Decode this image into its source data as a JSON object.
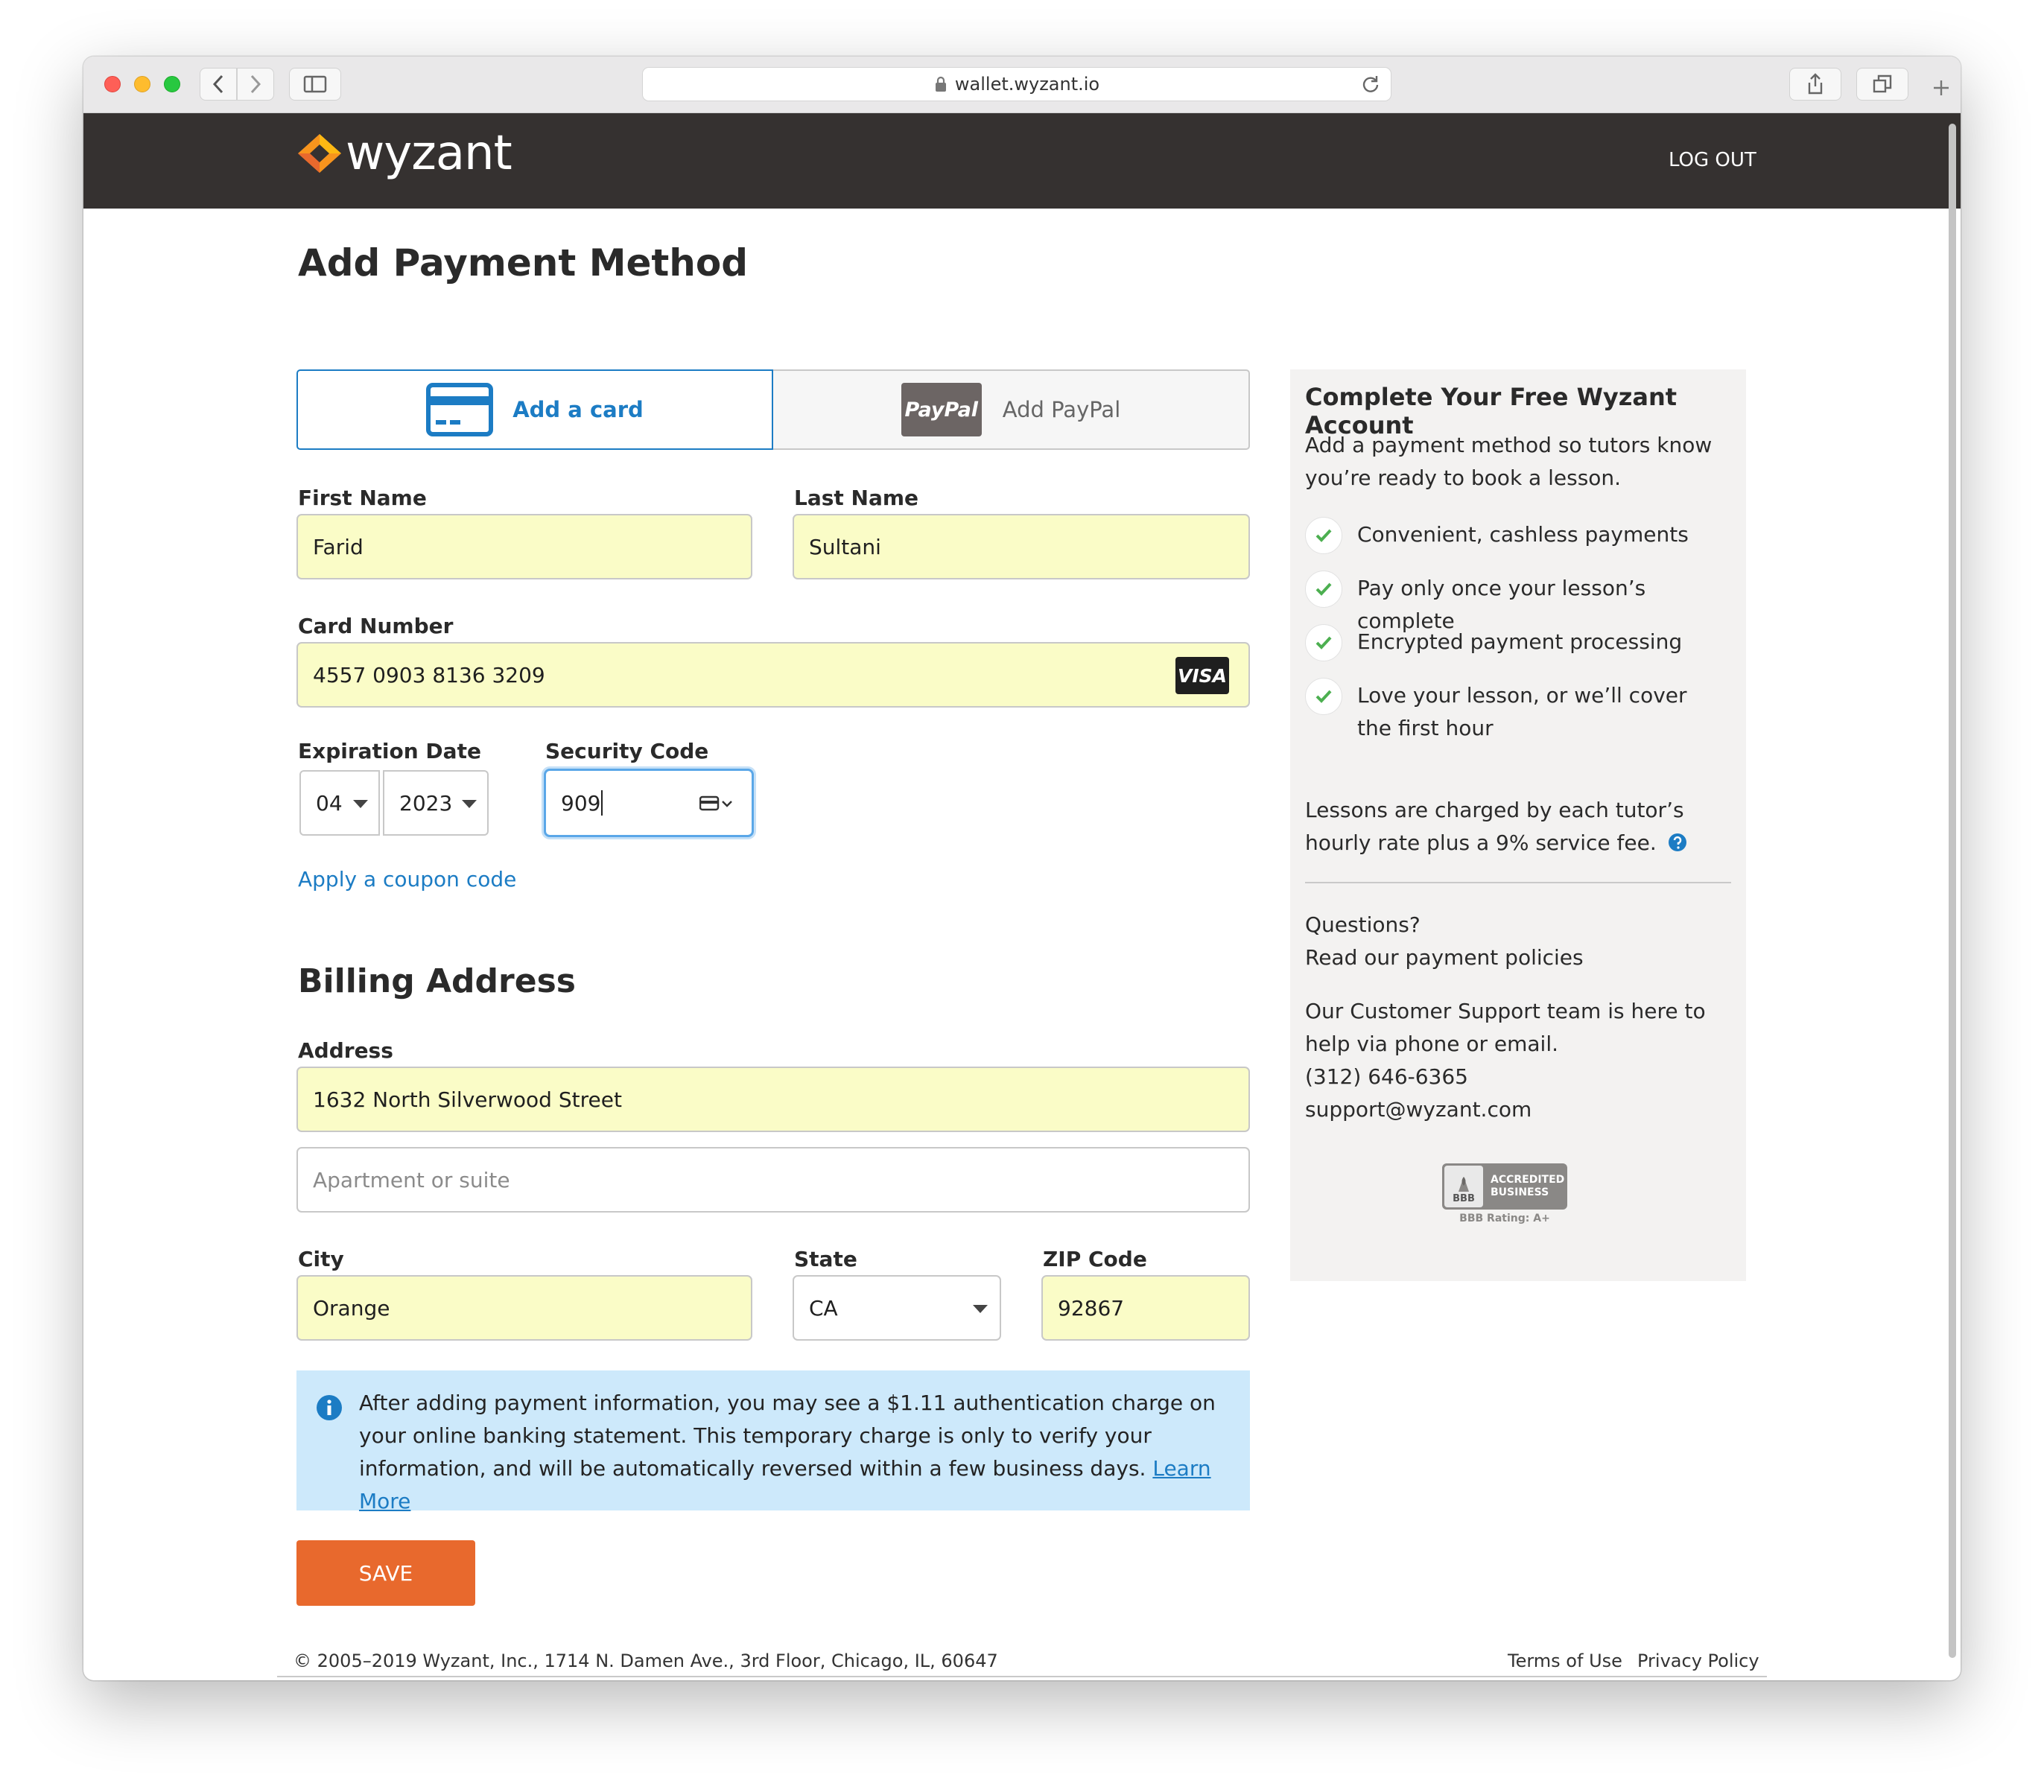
{
  "browser": {
    "url": "wallet.wyzant.io"
  },
  "header": {
    "logo_text": "wyzant",
    "logout_label": "LOG OUT"
  },
  "page": {
    "title": "Add Payment Method"
  },
  "tabs": {
    "card_label": "Add a card",
    "paypal_label": "Add PayPal",
    "paypal_logo": "PayPal"
  },
  "form": {
    "first_name_label": "First Name",
    "first_name_value": "Farid",
    "last_name_label": "Last Name",
    "last_name_value": "Sultani",
    "card_number_label": "Card Number",
    "card_number_value": "4557 0903 8136 3209",
    "card_brand": "VISA",
    "expiration_label": "Expiration Date",
    "exp_month": "04",
    "exp_year": "2023",
    "security_code_label": "Security Code",
    "security_code_value": "909",
    "coupon_link": "Apply a coupon code"
  },
  "billing": {
    "title": "Billing Address",
    "address_label": "Address",
    "address_value": "1632 North Silverwood Street",
    "apartment_placeholder": "Apartment or suite",
    "city_label": "City",
    "city_value": "Orange",
    "state_label": "State",
    "state_value": "CA",
    "zip_label": "ZIP Code",
    "zip_value": "92867"
  },
  "notice": {
    "text": "After adding payment information, you may see a $1.11 authentication charge on your online banking statement. This temporary charge is only to verify your information, and will be automatically reversed within a few business days.",
    "link": "Learn More"
  },
  "save_label": "SAVE",
  "sidebar": {
    "title": "Complete Your Free Wyzant Account",
    "intro": "Add a payment method so tutors know you’re ready to book a lesson.",
    "benefits": [
      "Convenient, cashless payments",
      "Pay only once your lesson’s complete",
      "Encrypted payment processing",
      "Love your lesson, or we’ll cover the first hour"
    ],
    "fee_text": "Lessons are charged by each tutor’s hourly rate plus a 9% service fee.",
    "questions": "Questions?",
    "policies_link": "Read our payment policies",
    "support_text": "Our Customer Support team is here to help via phone or email.",
    "phone": "(312) 646-6365",
    "email": "support@wyzant.com",
    "bbb_line1": "ACCREDITED",
    "bbb_line2": "BUSINESS",
    "bbb_mark": "BBB",
    "bbb_rating": "BBB Rating: A+"
  },
  "footer": {
    "copyright": "© 2005–2019 Wyzant, Inc., 1714 N. Damen Ave., 3rd Floor, Chicago, IL, 60647",
    "terms": "Terms of Use",
    "privacy": "Privacy Policy"
  },
  "colors": {
    "header_bg": "#353130",
    "accent_blue": "#1c7cc4",
    "save_orange": "#e8692d",
    "autofill_yellow": "#fafcc7",
    "notice_bg": "#cde9fb",
    "logo_orange": "#f7941d",
    "logo_yellow": "#fdb913",
    "check_green": "#4caf50"
  }
}
